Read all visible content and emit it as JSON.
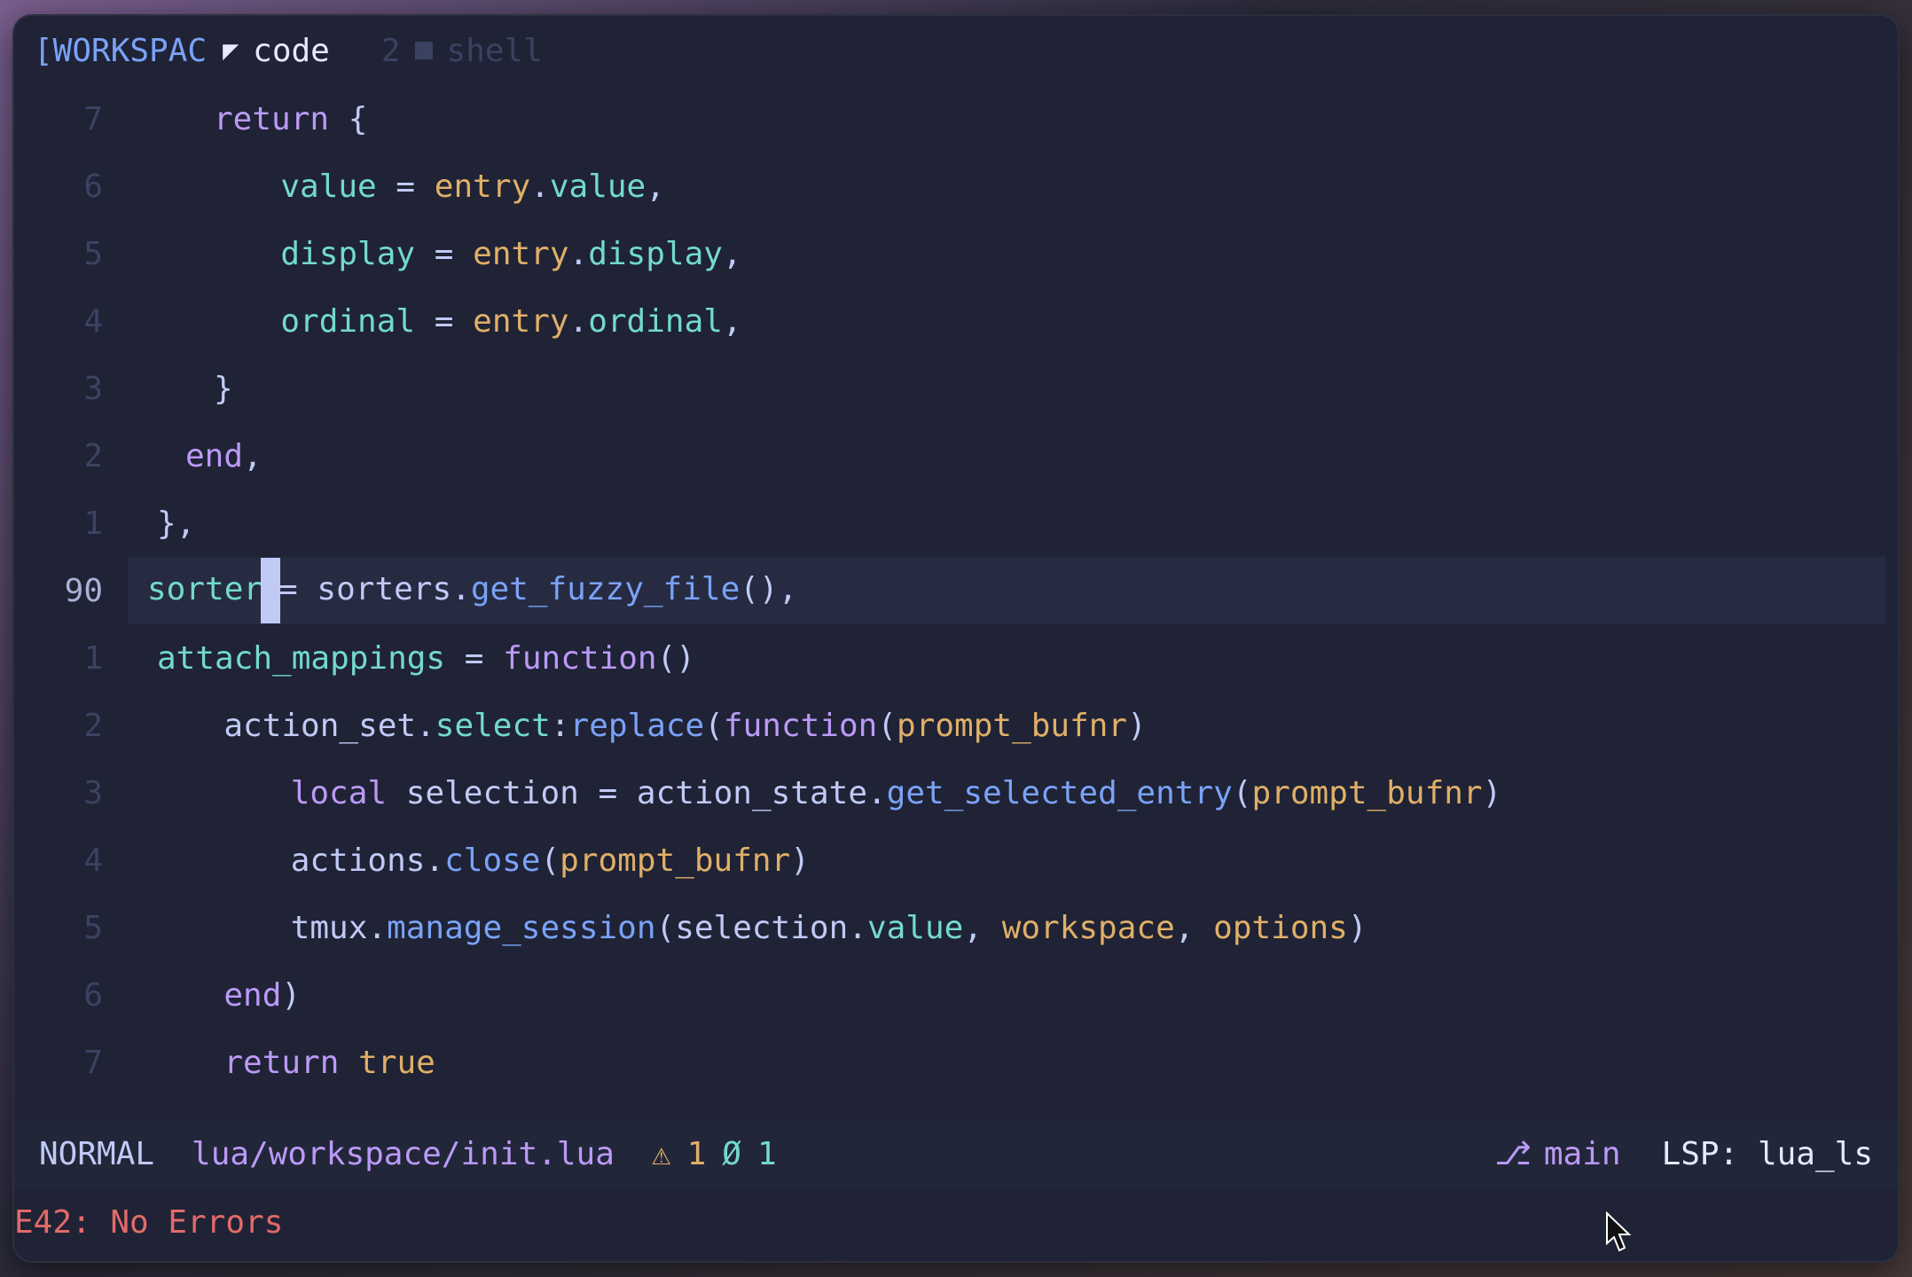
{
  "tabbar": {
    "workspace": "[WORKSPAC",
    "active_tab": {
      "index_icon": "◤",
      "name": "code"
    },
    "inactive_tab": {
      "index": "2",
      "name": "shell"
    }
  },
  "editor": {
    "lines": [
      {
        "num": "7",
        "code_html": "<span class='kw'>return</span> <span class='punc'>{</span>"
      },
      {
        "num": "6",
        "code_html": "  <span class='id'>value</span> <span class='punc'>=</span> <span class='val'>entry</span><span class='punc'>.</span><span class='prop'>value</span><span class='punc'>,</span>"
      },
      {
        "num": "5",
        "code_html": "  <span class='id'>display</span> <span class='punc'>=</span> <span class='val'>entry</span><span class='punc'>.</span><span class='prop'>display</span><span class='punc'>,</span>"
      },
      {
        "num": "4",
        "code_html": "  <span class='id'>ordinal</span> <span class='punc'>=</span> <span class='val'>entry</span><span class='punc'>.</span><span class='prop'>ordinal</span><span class='punc'>,</span>"
      },
      {
        "num": "3",
        "code_html": "<span class='punc'>}</span>"
      },
      {
        "num": "2",
        "code_html": "<span class='kw'>end</span><span class='punc'>,</span>"
      },
      {
        "num": "1",
        "code_html": "<span class='punc'>},</span>"
      },
      {
        "num": "90",
        "code_html": "<span class='id'>sorter</span><span class='cursor'></span><span class='punc'>=</span> <span class='punc'>sorters.</span><span class='fn'>get_fuzzy_file</span><span class='punc'>(),</span>"
      },
      {
        "num": "1",
        "code_html": "<span class='id'>attach_mappings</span> <span class='punc'>=</span> <span class='kw'>function</span><span class='punc'>()</span>"
      },
      {
        "num": "2",
        "code_html": "  <span class='punc'>action_set.</span><span class='prop'>select</span><span class='punc'>:</span><span class='fn'>replace</span><span class='punc'>(</span><span class='kw'>function</span><span class='punc'>(</span><span class='val'>prompt_bufnr</span><span class='punc'>)</span>"
      },
      {
        "num": "3",
        "code_html": "    <span class='kw'>local</span> <span class='punc'>selection</span> <span class='punc'>=</span> <span class='punc'>action_state.</span><span class='fn'>get_selected_entry</span><span class='punc'>(</span><span class='val'>prompt_bufnr</span><span class='punc'>)</span>"
      },
      {
        "num": "4",
        "code_html": "    <span class='punc'>actions.</span><span class='fn'>close</span><span class='punc'>(</span><span class='val'>prompt_bufnr</span><span class='punc'>)</span>"
      },
      {
        "num": "5",
        "code_html": "    <span class='punc'>tmux.</span><span class='fn'>manage_session</span><span class='punc'>(selection.</span><span class='prop'>value</span><span class='punc'>,</span> <span class='val'>workspace</span><span class='punc'>,</span> <span class='val'>options</span><span class='punc'>)</span>"
      },
      {
        "num": "6",
        "code_html": "  <span class='kw'>end</span><span class='punc'>)</span>"
      },
      {
        "num": "7",
        "code_html": "  <span class='kw'>return</span> <span class='val'>true</span>"
      }
    ]
  },
  "statusline": {
    "mode": "NORMAL",
    "file": "lua/workspace/init.lua",
    "warn_icon": "⚠",
    "warn_count": "1",
    "info_icon": "Ø",
    "info_count": "1",
    "branch_icon": "⎇",
    "branch": "main",
    "lsp": "LSP: lua_ls"
  },
  "cmdline": "E42: No Errors"
}
